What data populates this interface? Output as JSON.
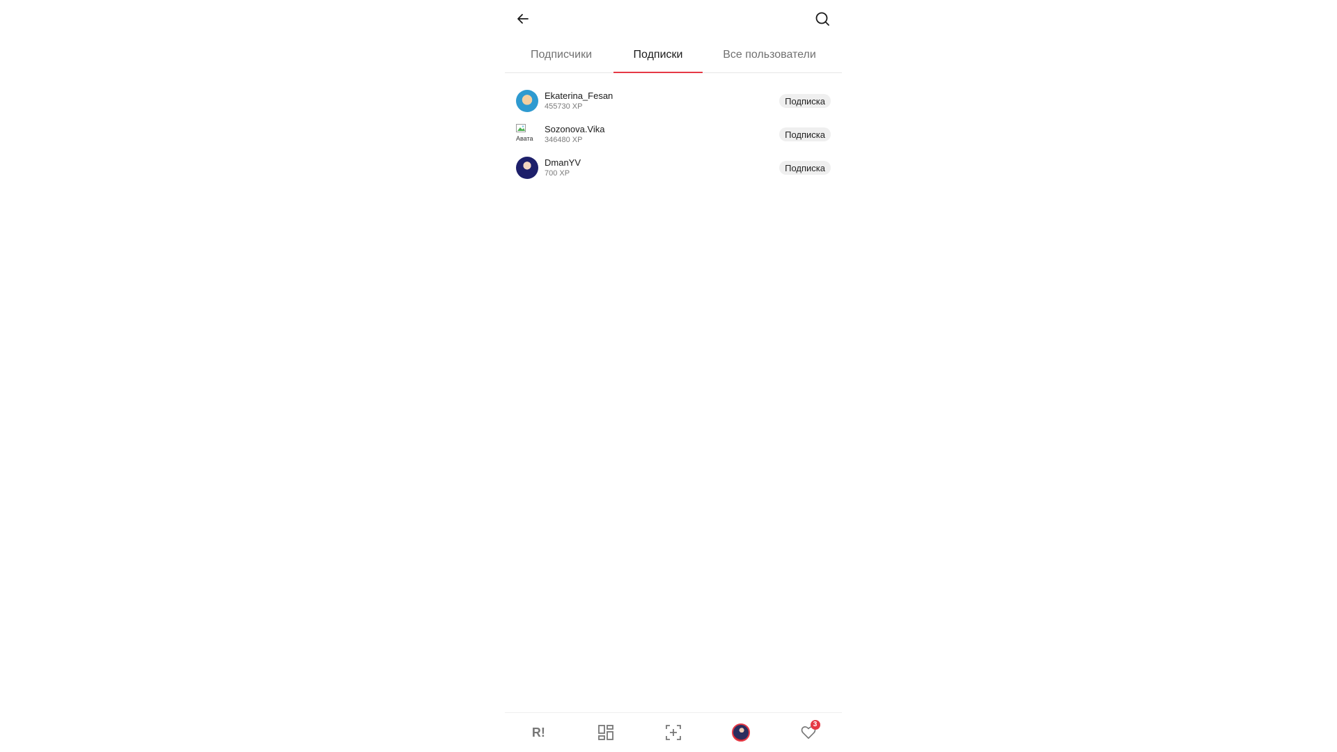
{
  "tabs": [
    {
      "label": "Подписчики",
      "active": false
    },
    {
      "label": "Подписки",
      "active": true
    },
    {
      "label": "Все пользователи",
      "active": false
    }
  ],
  "users": [
    {
      "name": "Ekaterina_Fesan",
      "xp": "455730 XP",
      "button": "Подписка",
      "avatar": "photo"
    },
    {
      "name": "Sozonova.Vika",
      "xp": "346480 XP",
      "button": "Подписка",
      "avatar": "broken-image",
      "avatar_alt": "Авата"
    },
    {
      "name": "DmanYV",
      "xp": "700 XP",
      "button": "Подписка",
      "avatar": "photo"
    }
  ],
  "bottom_nav": {
    "logo_text": "R!",
    "notifications_count": "3"
  },
  "colors": {
    "accent": "#e53945",
    "chip_bg": "#efefef"
  }
}
